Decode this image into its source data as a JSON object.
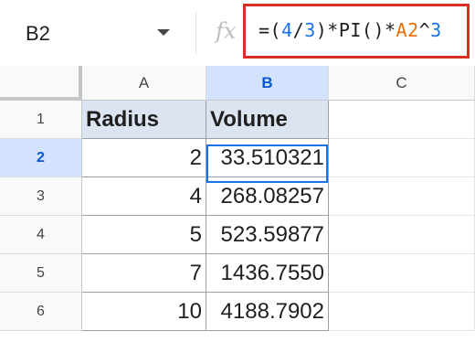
{
  "formula_bar": {
    "name_box": "B2",
    "fx_label": "fx",
    "formula_tokens": [
      {
        "text": "=(",
        "kind": "default"
      },
      {
        "text": "4",
        "kind": "num"
      },
      {
        "text": "/",
        "kind": "default"
      },
      {
        "text": "3",
        "kind": "num"
      },
      {
        "text": ")*PI()*",
        "kind": "default"
      },
      {
        "text": "A2",
        "kind": "ref"
      },
      {
        "text": "^",
        "kind": "default"
      },
      {
        "text": "3",
        "kind": "num"
      }
    ]
  },
  "columns": [
    "A",
    "B",
    "C"
  ],
  "selected_column": "B",
  "rows": [
    {
      "num": "1",
      "a": "Radius",
      "b": "Volume"
    },
    {
      "num": "2",
      "a": "2",
      "b": "33.510321"
    },
    {
      "num": "3",
      "a": "4",
      "b": "268.08257"
    },
    {
      "num": "4",
      "a": "5",
      "b": "523.59877"
    },
    {
      "num": "5",
      "a": "7",
      "b": "1436.7550"
    },
    {
      "num": "6",
      "a": "10",
      "b": "4188.7902"
    }
  ],
  "selected_row": "2",
  "colors": {
    "accent": "#1a73e8",
    "highlight_border": "#d93025",
    "header_fill": "#dbe4f0"
  }
}
